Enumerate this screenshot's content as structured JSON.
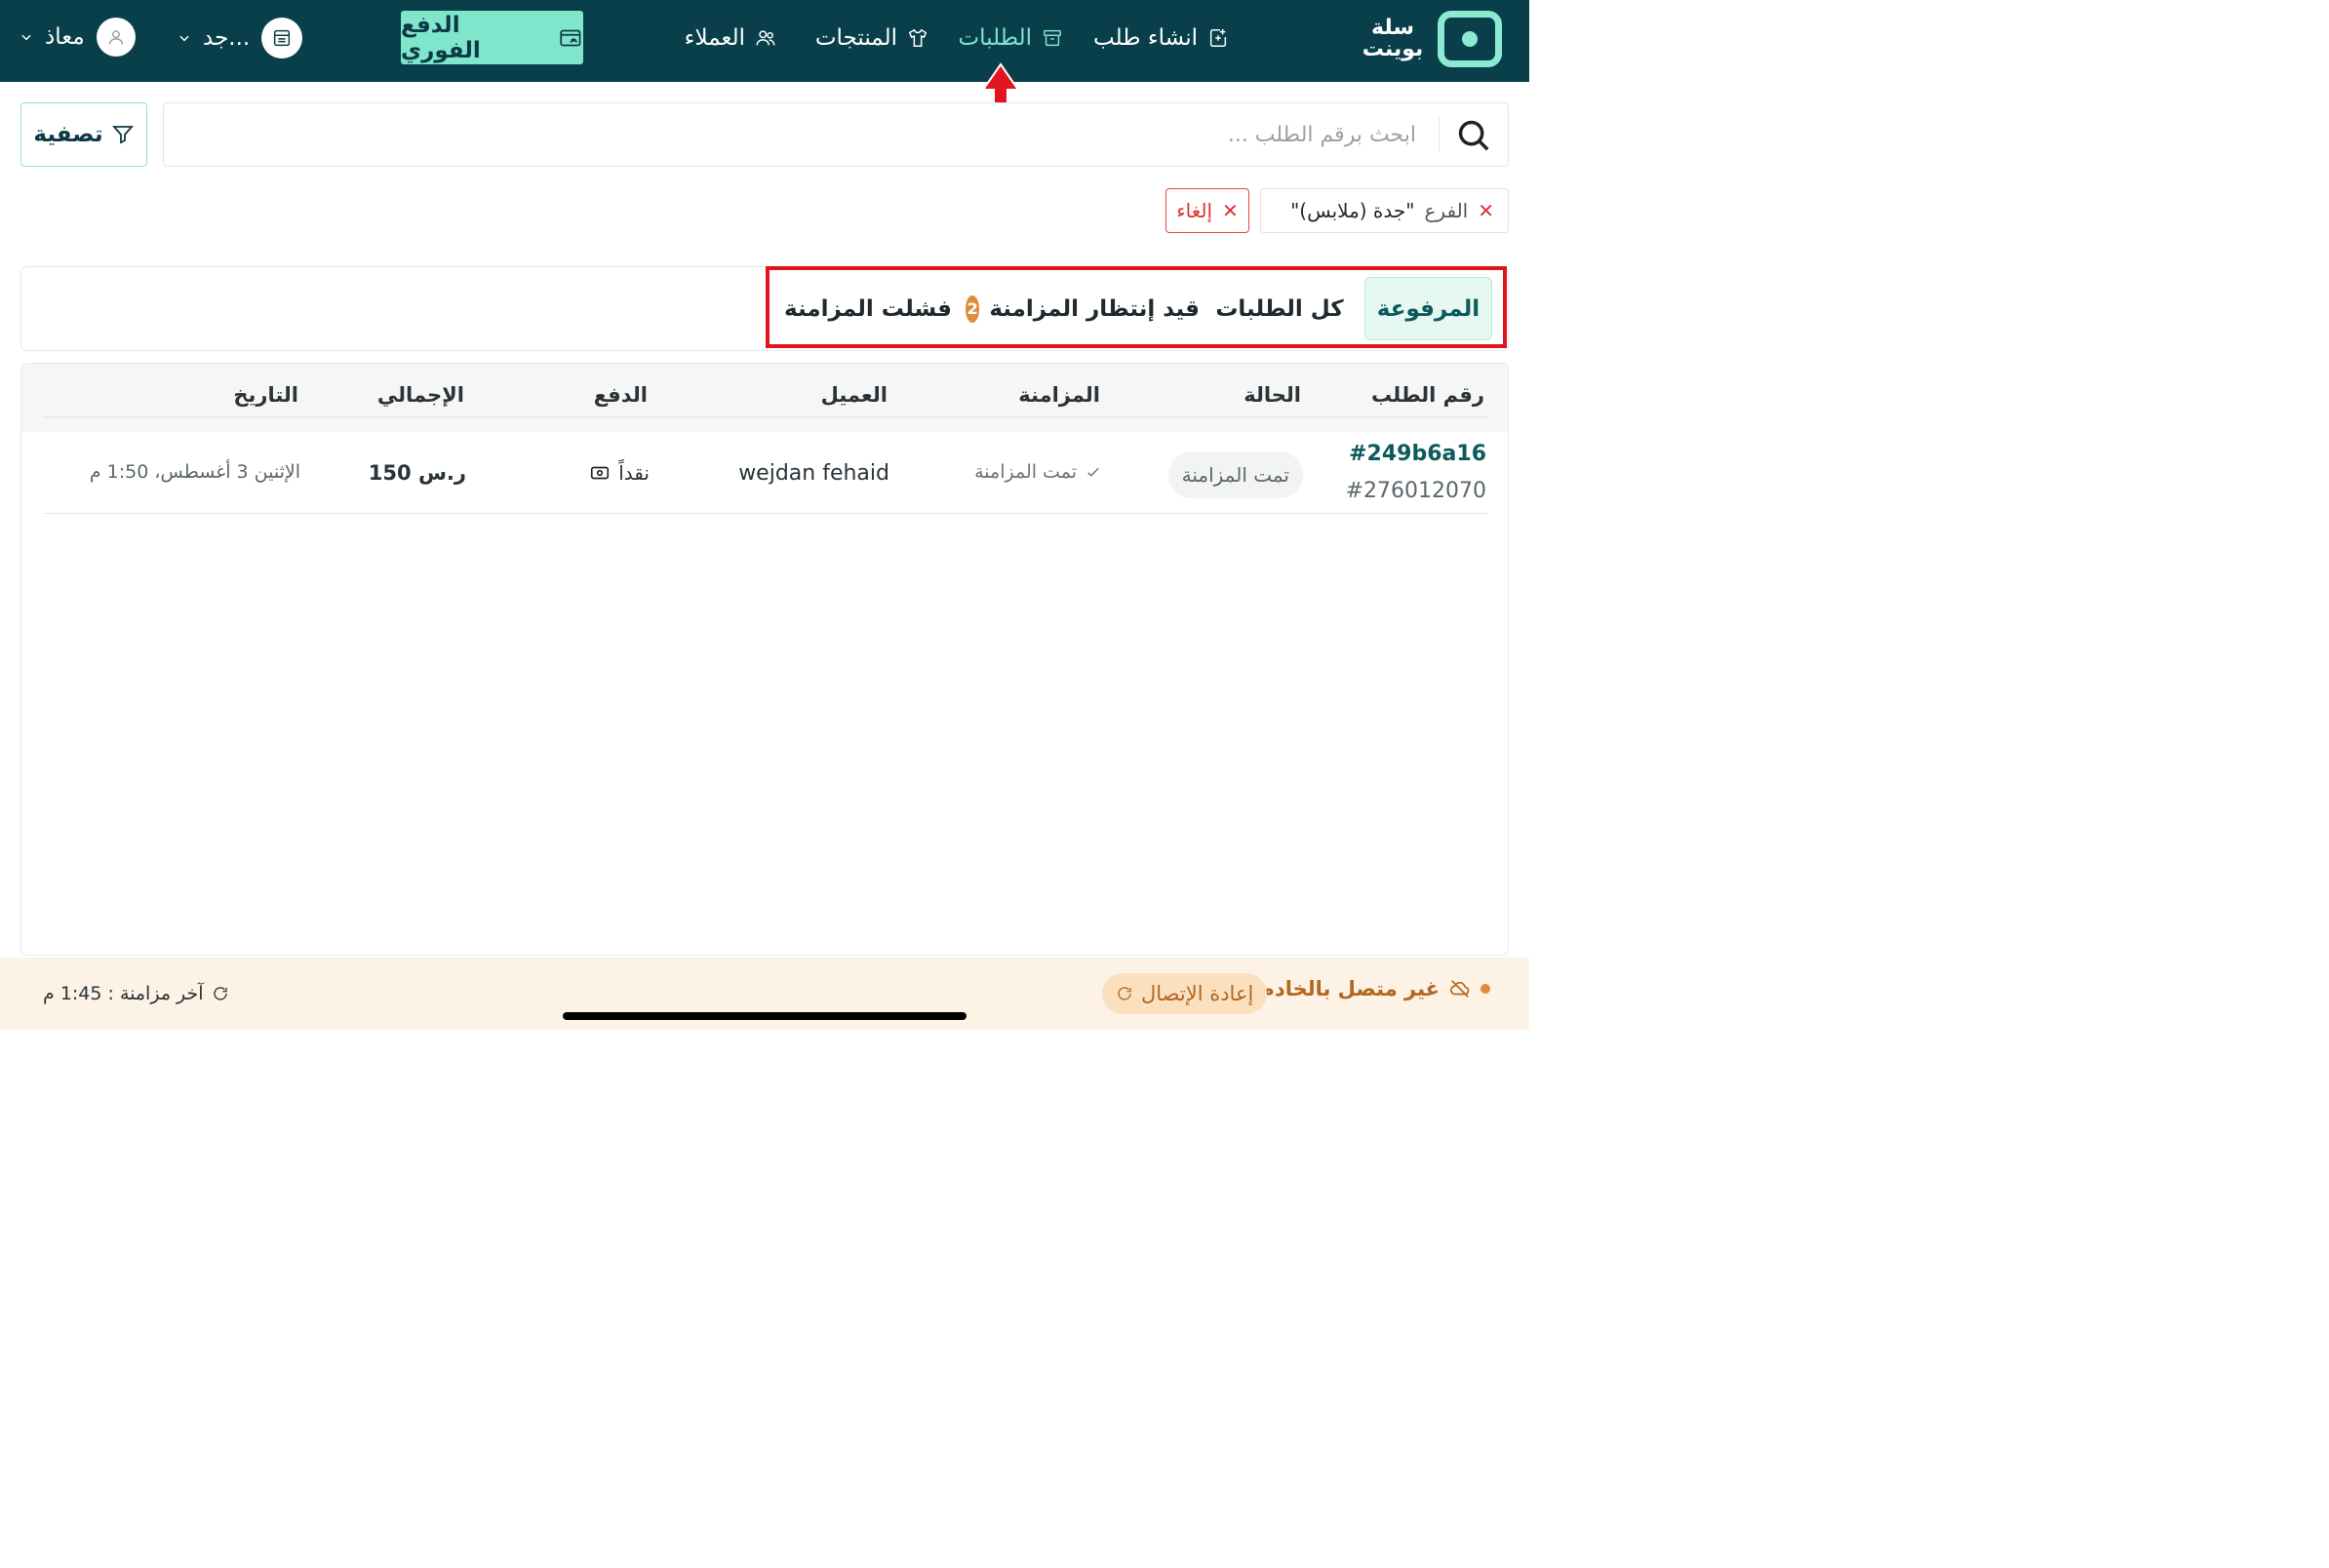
{
  "brand": {
    "name": "سلة بوينت",
    "colors": {
      "topbar": "#093f4b",
      "accent": "#7fe6cc",
      "warning": "#e08a3c",
      "error": "#d9342b"
    }
  },
  "nav": {
    "create_order": {
      "label": "انشاء طلب",
      "icon": "create-order-icon"
    },
    "orders": {
      "label": "الطلبات",
      "icon": "archive-icon",
      "active": true
    },
    "products": {
      "label": "المنتجات",
      "icon": "shirt-icon"
    },
    "customers": {
      "label": "العملاء",
      "icon": "users-icon"
    },
    "instant_pay": {
      "label": "الدفع الفوري",
      "icon": "wallet-icon"
    },
    "branch": {
      "label": "جد...",
      "icon": "store-icon"
    },
    "user": {
      "label": "معاذ",
      "icon": "user-icon"
    }
  },
  "search": {
    "placeholder": "ابحث برقم الطلب ...",
    "value": ""
  },
  "filter_button": {
    "label": "تصفية",
    "icon": "filter-icon"
  },
  "chips": {
    "branch": {
      "label": "الفرع",
      "value": "\"جدة (ملابس)\""
    },
    "cancel": {
      "label": "إلغاء"
    }
  },
  "tabs": {
    "paid": {
      "label": "المرفوعة",
      "active": true
    },
    "all": {
      "label": "كل الطلبات"
    },
    "pending": {
      "label": "قيد إنتظار المزامنة",
      "count": "2"
    },
    "failed": {
      "label": "فشلت المزامنة"
    }
  },
  "table": {
    "columns": {
      "order_number": "رقم الطلب",
      "status": "الحالة",
      "sync": "المزامنة",
      "customer": "العميل",
      "payment": "الدفع",
      "total": "الإجمالي",
      "date": "التاريخ"
    },
    "rows": [
      {
        "order_id": "#249b6a16",
        "order_number": "#276012070",
        "status": "تمت المزامنة",
        "sync": "تمت المزامنة",
        "customer": "wejdan fehaid",
        "payment": "نقداً",
        "total": "150 ر.س",
        "date": "الإثنين 3 أغسطس، 1:50 م"
      }
    ]
  },
  "footer": {
    "connection": "غير متصل بالخادم",
    "reconnect": "إعادة الإتصال",
    "last_sync": "آخر مزامنة : 1:45 م"
  }
}
